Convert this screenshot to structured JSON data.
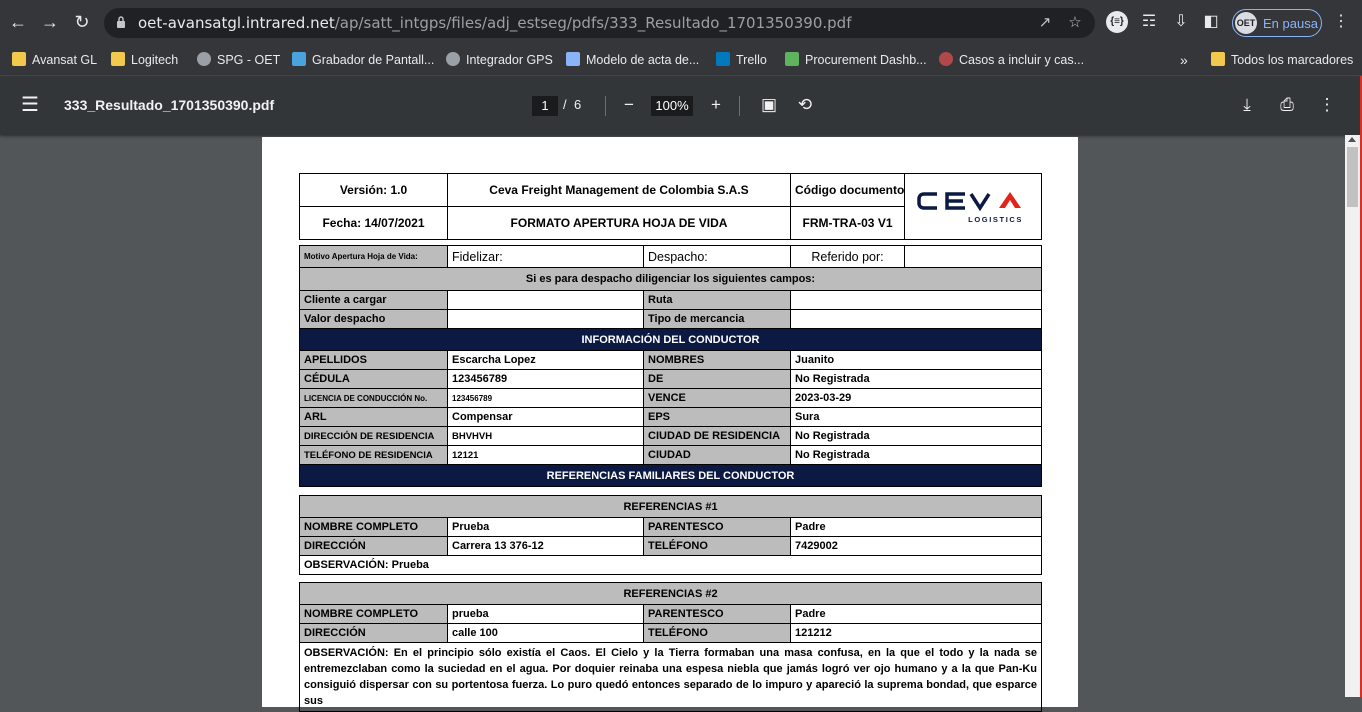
{
  "browser": {
    "url_host": "oet-avansatgl.intrared.net",
    "url_path": "/ap/satt_intgps/files/adj_estseg/pdfs/333_Resultado_1701350390.pdf",
    "profile_initials": "OET",
    "profile_status": "En pausa"
  },
  "bookmarks": [
    {
      "label": "Avansat GL",
      "icon": "folder-icon"
    },
    {
      "label": "Logitech",
      "icon": "folder-icon"
    },
    {
      "label": "SPG - OET",
      "icon": "globe-icon"
    },
    {
      "label": "Grabador de Pantall...",
      "icon": "camera-icon"
    },
    {
      "label": "Integrador GPS",
      "icon": "globe-icon"
    },
    {
      "label": "Modelo de acta de...",
      "icon": "doc-icon"
    },
    {
      "label": "Trello",
      "icon": "trello-icon"
    },
    {
      "label": "Procurement Dashb...",
      "icon": "chart-icon"
    },
    {
      "label": "Casos a incluir y cas...",
      "icon": "app-icon"
    }
  ],
  "bookmarks_overflow": "»",
  "bookmarks_all": "Todos los marcadores",
  "pdf": {
    "filename": "333_Resultado_1701350390.pdf",
    "page": "1",
    "page_sep": "/",
    "total_pages": "6",
    "zoom": "100%"
  },
  "doc": {
    "version": "Versión: 1.0",
    "company": "Ceva Freight Management de Colombia S.A.S",
    "code_label": "Código documento",
    "date": "Fecha: 14/07/2021",
    "form_title": "FORMATO APERTURA HOJA DE VIDA",
    "form_code": "FRM-TRA-03 V1",
    "logo_text": "ceva",
    "logo_sub": "LOGISTICS",
    "motivo_label": "Motivo Apertura Hoja de Vida:",
    "fidelizar": "Fidelizar:",
    "despacho": "Despacho:",
    "referido": "Referido por:",
    "despacho_note": "Si es para despacho diligenciar los siguientes campos:",
    "cliente": "Cliente a cargar",
    "ruta": "Ruta",
    "valor": "Valor despacho",
    "tipo": "Tipo de mercancia",
    "info_header": "INFORMACIÓN DEL CONDUCTOR",
    "driver": [
      [
        "APELLIDOS",
        "Escarcha  Lopez",
        "NOMBRES",
        "Juanito"
      ],
      [
        "CÉDULA",
        "123456789",
        "DE",
        "No Registrada"
      ],
      [
        "LICENCIA DE CONDUCCIÓN No.",
        "123456789",
        "VENCE",
        "2023-03-29"
      ],
      [
        "ARL",
        "Compensar",
        "EPS",
        "Sura"
      ],
      [
        "DIRECCIÓN DE RESIDENCIA",
        "BHVHVH",
        "CIUDAD DE RESIDENCIA",
        "No Registrada"
      ],
      [
        "TELÉFONO DE RESIDENCIA",
        "12121",
        "CIUDAD",
        "No Registrada"
      ]
    ],
    "ref_header": "REFERENCIAS FAMILIARES DEL CONDUCTOR",
    "ref1": {
      "title": "REFERENCIAS #1",
      "nombre_label": "NOMBRE COMPLETO",
      "nombre": "Prueba",
      "parentesco_label": "PARENTESCO",
      "parentesco": "Padre",
      "direccion_label": "DIRECCIÓN",
      "direccion": "Carrera 13 376-12",
      "telefono_label": "TELÉFONO",
      "telefono": "7429002",
      "obs_label": "OBSERVACIÓN:",
      "obs": "Prueba"
    },
    "ref2": {
      "title": "REFERENCIAS #2",
      "nombre_label": "NOMBRE COMPLETO",
      "nombre": "prueba",
      "parentesco_label": "PARENTESCO",
      "parentesco": "Padre",
      "direccion_label": "DIRECCIÓN",
      "direccion": "calle 100",
      "telefono_label": "TELÉFONO",
      "telefono": "121212",
      "obs_label": "OBSERVACIÓN:",
      "obs": "En el principio sólo existía el Caos. El Cielo y la Tierra formaban una masa confusa, en la que el todo y la nada se entremezclaban como la suciedad en el agua. Por doquier reinaba una espesa niebla que jamás logró ver ojo humano y a la que Pan-Ku consiguió dispersar con su portentosa fuerza. Lo puro quedó entonces separado de lo impuro y apareció la suprema bondad, que esparce sus"
    }
  }
}
